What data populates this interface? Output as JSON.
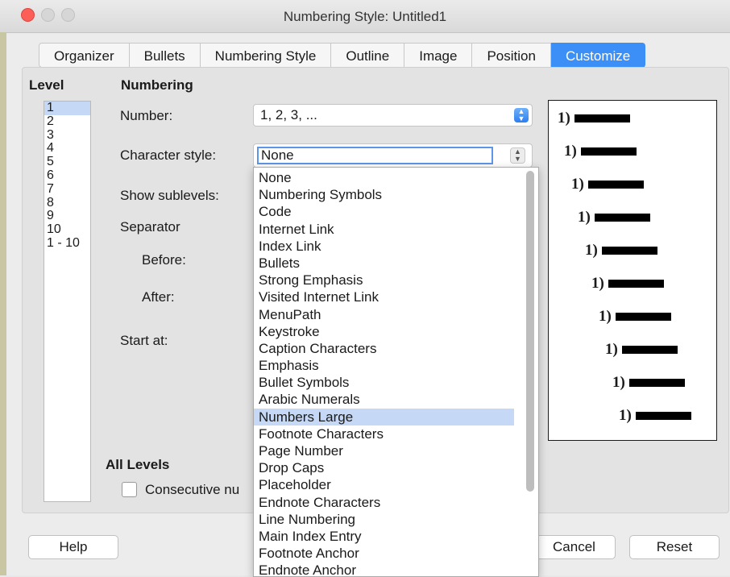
{
  "window": {
    "title": "Numbering Style: Untitled1"
  },
  "tabs": [
    "Organizer",
    "Bullets",
    "Numbering Style",
    "Outline",
    "Image",
    "Position",
    "Customize"
  ],
  "active_tab": "Customize",
  "level": {
    "heading": "Level",
    "items": [
      "1",
      "2",
      "3",
      "4",
      "5",
      "6",
      "7",
      "8",
      "9",
      "10",
      "1 - 10"
    ],
    "selected": "1"
  },
  "numbering": {
    "heading": "Numbering",
    "number_label": "Number:",
    "number_value": "1, 2, 3, ...",
    "char_style_label": "Character style:",
    "char_style_value": "None",
    "show_sublevels_label": "Show sublevels:",
    "separator_label": "Separator",
    "before_label": "Before:",
    "after_label": "After:",
    "start_at_label": "Start at:"
  },
  "dropdown": {
    "items": [
      "None",
      "Numbering Symbols",
      "Code",
      "Internet Link",
      "Index Link",
      "Bullets",
      "Strong Emphasis",
      "Visited Internet Link",
      "MenuPath",
      "Keystroke",
      "Caption Characters",
      "Emphasis",
      "Bullet Symbols",
      "Arabic Numerals",
      "Numbers Large",
      "Footnote Characters",
      "Page Number",
      "Drop Caps",
      "Placeholder",
      "Endnote Characters",
      "Line Numbering",
      "Main Index Entry",
      "Footnote Anchor",
      "Endnote Anchor"
    ],
    "highlighted": "Numbers Large"
  },
  "preview": {
    "rows": [
      "1)",
      "1)",
      "1)",
      "1)",
      "1)",
      "1)",
      "1)",
      "1)",
      "1)",
      "1)"
    ]
  },
  "all_levels": {
    "heading": "All Levels",
    "consecutive_label": "Consecutive nu"
  },
  "buttons": {
    "help": "Help",
    "cancel": "Cancel",
    "reset": "Reset"
  },
  "colors": {
    "accent": "#3b8ff6",
    "highlight": "#c5d8f6",
    "close": "#fc5f57"
  }
}
